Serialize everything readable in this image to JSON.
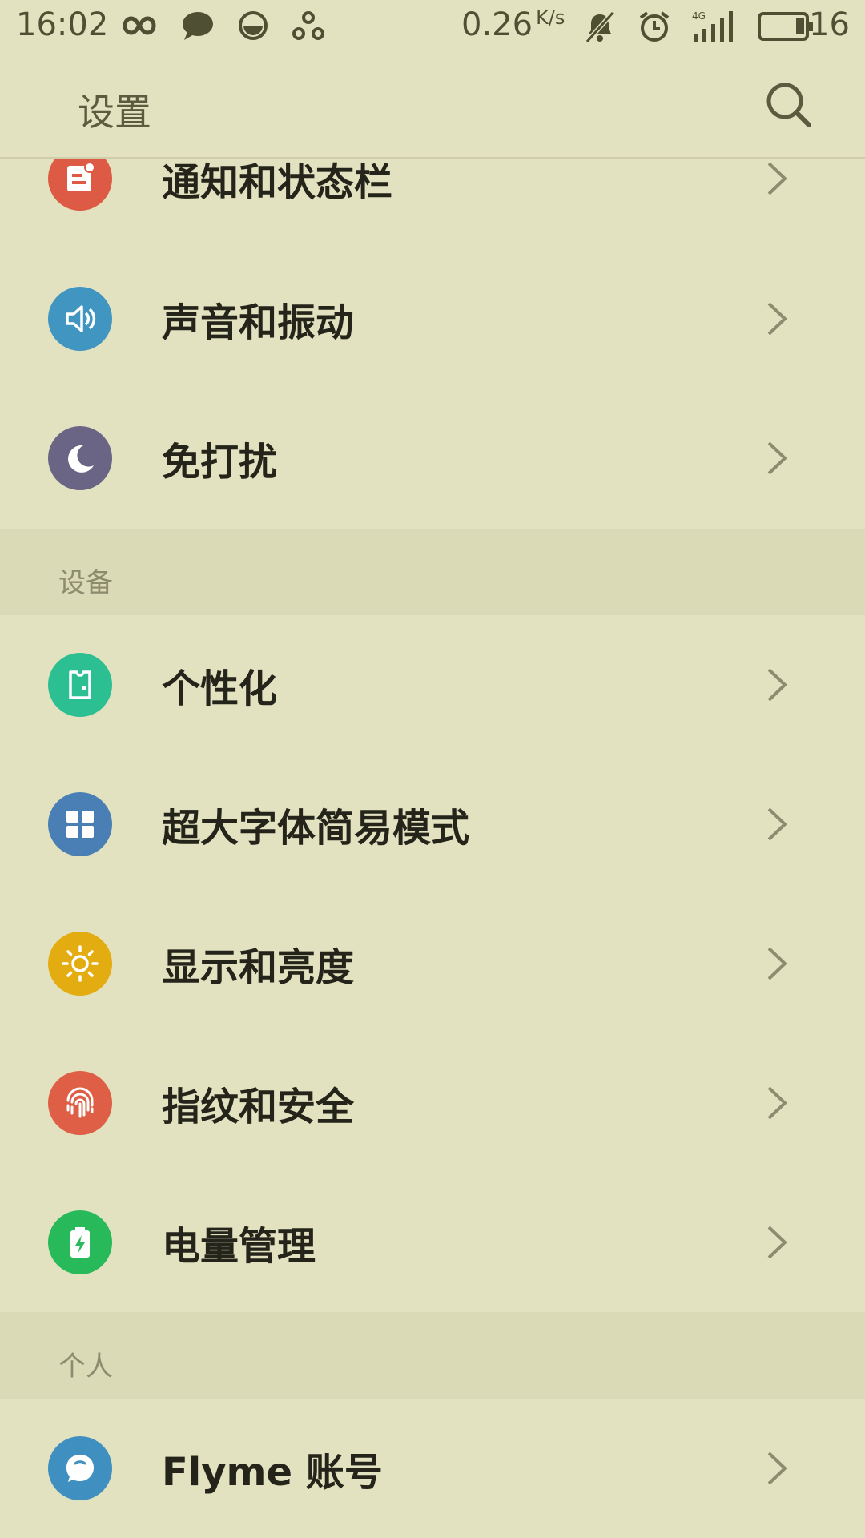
{
  "status_bar": {
    "time": "16:02",
    "net_speed": "0.26",
    "net_speed_unit": "K/s",
    "network_label": "4G",
    "battery_percent": "16"
  },
  "header": {
    "title": "设置"
  },
  "sections": {
    "device_label": "设备",
    "personal_label": "个人"
  },
  "items": {
    "notifications": "通知和状态栏",
    "sound": "声音和振动",
    "dnd": "免打扰",
    "personalize": "个性化",
    "big_font": "超大字体简易模式",
    "display": "显示和亮度",
    "fingerprint": "指纹和安全",
    "battery": "电量管理",
    "flyme": "Flyme 账号"
  },
  "colors": {
    "notifications": "#dd5b45",
    "sound": "#4096c0",
    "dnd": "#6a6584",
    "personalize": "#2bbf92",
    "big_font": "#4a7fb5",
    "display": "#e3ac10",
    "fingerprint": "#de5f45",
    "battery": "#27b95a",
    "flyme": "#3f8fc0"
  }
}
